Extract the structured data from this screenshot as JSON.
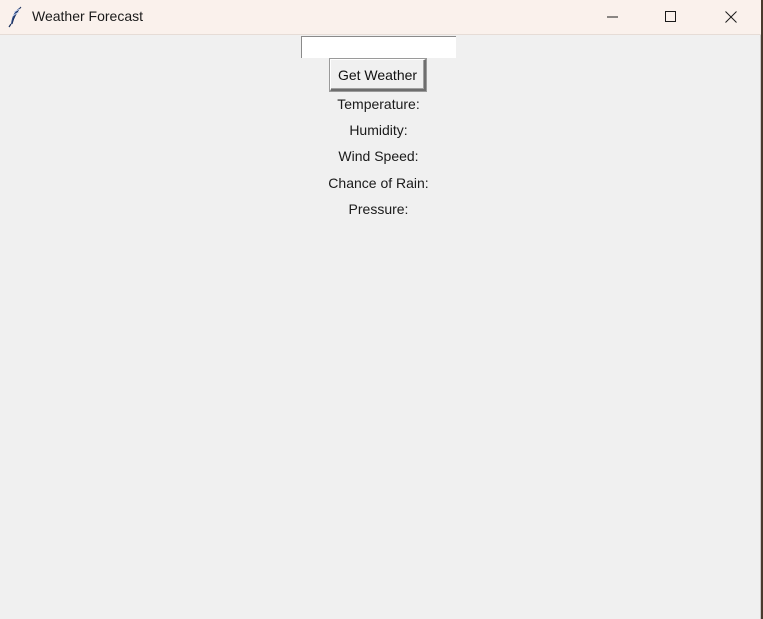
{
  "window": {
    "title": "Weather Forecast",
    "app_icon": "feather-icon",
    "controls": {
      "minimize_icon": "minimize-icon",
      "maximize_icon": "maximize-icon",
      "close_icon": "close-icon"
    }
  },
  "form": {
    "city_value": "",
    "button_label": "Get Weather"
  },
  "results": {
    "temperature_label": "Temperature:",
    "humidity_label": "Humidity:",
    "wind_speed_label": "Wind Speed:",
    "chance_of_rain_label": "Chance of Rain:",
    "pressure_label": "Pressure:"
  },
  "colors": {
    "titlebar_bg": "#faf1ec",
    "window_bg": "#f0f0f0"
  }
}
